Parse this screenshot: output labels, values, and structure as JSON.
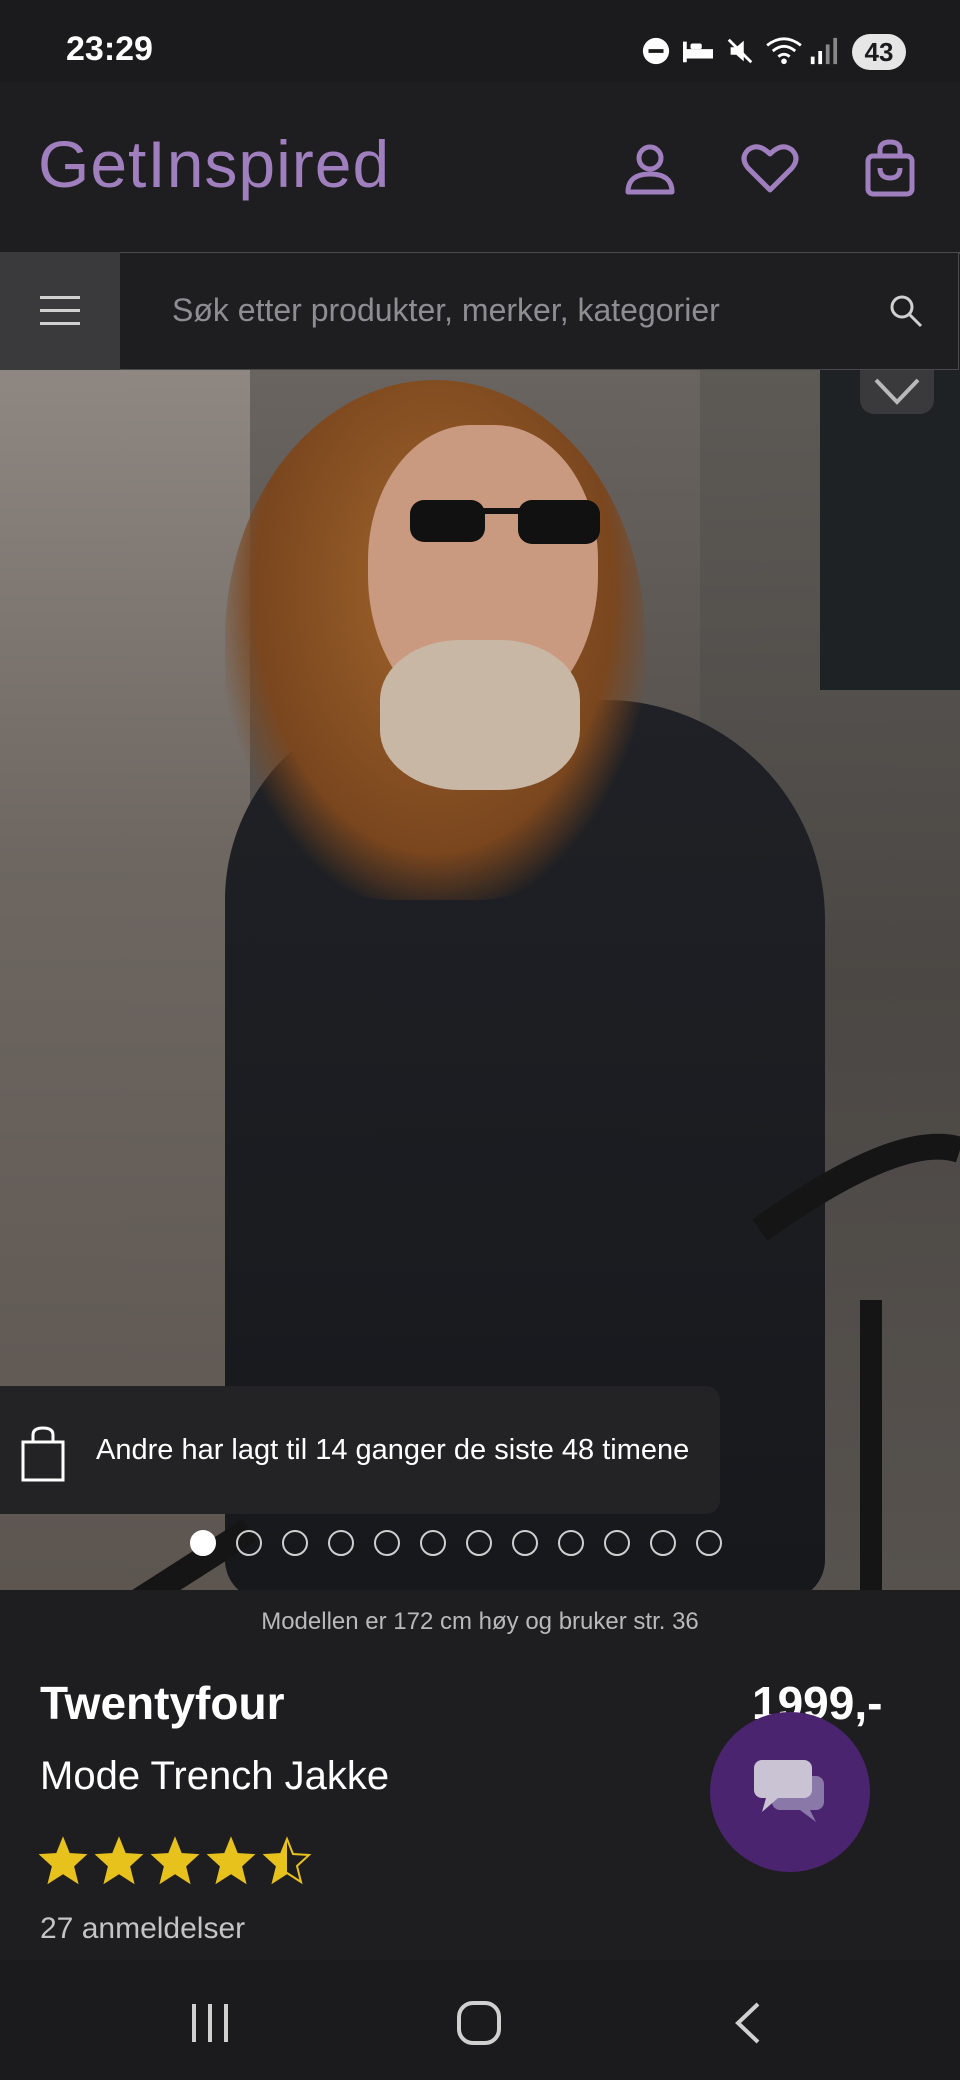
{
  "status_bar": {
    "time": "23:29",
    "battery": "43"
  },
  "header": {
    "logo": "GetInspired"
  },
  "search": {
    "placeholder": "Søk etter produkter, merker, kategorier"
  },
  "gallery": {
    "toast": "Andre har lagt til 14 ganger de siste 48 timene",
    "dot_count": 12,
    "active_index": 0
  },
  "product": {
    "caption": "Modellen er 172 cm høy og bruker str. 36",
    "brand": "Twentyfour",
    "name": "Mode Trench Jakke",
    "price": "1999,-",
    "rating": 4.5,
    "reviews": "27 anmeldelser"
  },
  "colors": {
    "accent": "#a07fbf",
    "chat": "#4b2470",
    "star": "#e8c21c",
    "background": "#1e1e20"
  }
}
